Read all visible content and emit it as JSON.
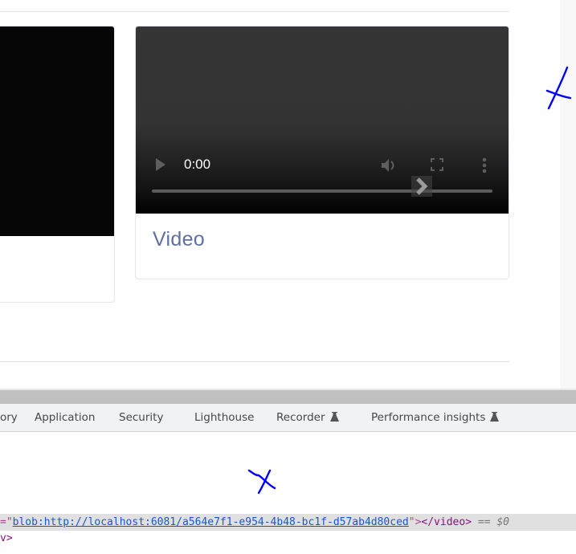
{
  "page": {
    "cards": [
      {
        "id": "left",
        "media": "video",
        "title": ""
      },
      {
        "id": "right",
        "media": "video",
        "title": "Video",
        "player": {
          "current_time": "0:00",
          "progress_fraction": 0.0,
          "icons": [
            "play-icon",
            "volume-icon",
            "fullscreen-icon",
            "more-options-icon",
            "next-chevron-icon"
          ]
        }
      }
    ]
  },
  "devtools": {
    "tabs": [
      {
        "label": "ory",
        "icon": ""
      },
      {
        "label": "Application",
        "icon": ""
      },
      {
        "label": "Security",
        "icon": ""
      },
      {
        "label": "Lighthouse",
        "icon": ""
      },
      {
        "label": "Recorder",
        "icon": "flask-icon"
      },
      {
        "label": "Performance insights",
        "icon": "flask-icon"
      }
    ],
    "elements": {
      "selected_line": {
        "prefix": "=\"",
        "src_url": "blob:http://localhost:6081/a564e7f1-e954-4b48-bc1f-d57ab4d80ced",
        "suffix_quote": "\">",
        "closing_tag": "</video>",
        "console_ref": "== $0"
      },
      "next_line": "v>"
    }
  },
  "colors": {
    "title_accent": "#5f6f9e",
    "link": "#1a55d4",
    "tag": "#881280",
    "annotation": "#0000ff"
  }
}
